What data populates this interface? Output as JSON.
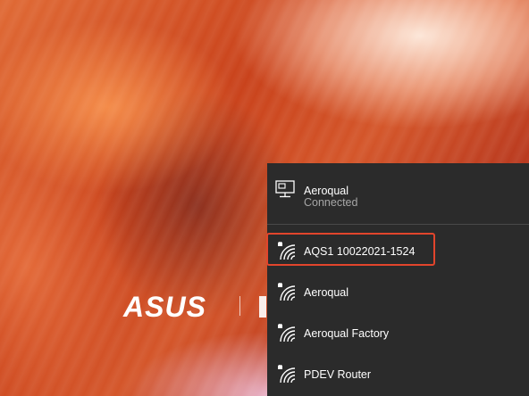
{
  "desktop": {
    "brand_text": "ASUS"
  },
  "wifi_flyout": {
    "connected": {
      "name": "Aeroqual",
      "status": "Connected",
      "icon": "ethernet-monitor-icon"
    },
    "networks": [
      {
        "name": "AQS1 10022021-1524",
        "icon": "secured-wifi-icon",
        "highlighted": true
      },
      {
        "name": "Aeroqual",
        "icon": "secured-wifi-icon",
        "highlighted": false
      },
      {
        "name": "Aeroqual Factory",
        "icon": "secured-wifi-icon",
        "highlighted": false
      },
      {
        "name": "PDEV Router",
        "icon": "secured-wifi-icon",
        "highlighted": false
      }
    ]
  },
  "colors": {
    "flyout_bg": "#2b2b2b",
    "highlight_border": "#e2452c",
    "secondary_text": "#a6a6a6"
  }
}
